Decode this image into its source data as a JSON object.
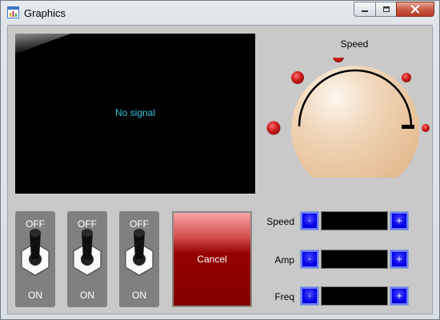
{
  "window": {
    "title": "Graphics",
    "app_icon": "chart-app-icon",
    "caption_buttons": [
      "minimize-icon",
      "maximize-icon",
      "close-icon"
    ]
  },
  "display": {
    "status_text": "No signal",
    "text_color": "#35c6df",
    "background": "#000000"
  },
  "speed_knob": {
    "label": "Speed",
    "knob_color": "#e8c29a",
    "indicator_color": "#c41e1e"
  },
  "toggles": [
    {
      "off_label": "OFF",
      "on_label": "ON",
      "state": "off"
    },
    {
      "off_label": "OFF",
      "on_label": "ON",
      "state": "off"
    },
    {
      "off_label": "OFF",
      "on_label": "ON",
      "state": "off"
    }
  ],
  "cancel_button": {
    "label": "Cancel",
    "color": "#8b0000"
  },
  "controls": [
    {
      "label": "Speed",
      "minus": "-",
      "plus": "+",
      "value": ""
    },
    {
      "label": "Amp",
      "minus": "-",
      "plus": "+",
      "value": ""
    },
    {
      "label": "Freq",
      "minus": "-",
      "plus": "+",
      "value": ""
    }
  ],
  "colors": {
    "accent_blue": "#0000e6",
    "panel_gray": "#c9c9c9"
  }
}
